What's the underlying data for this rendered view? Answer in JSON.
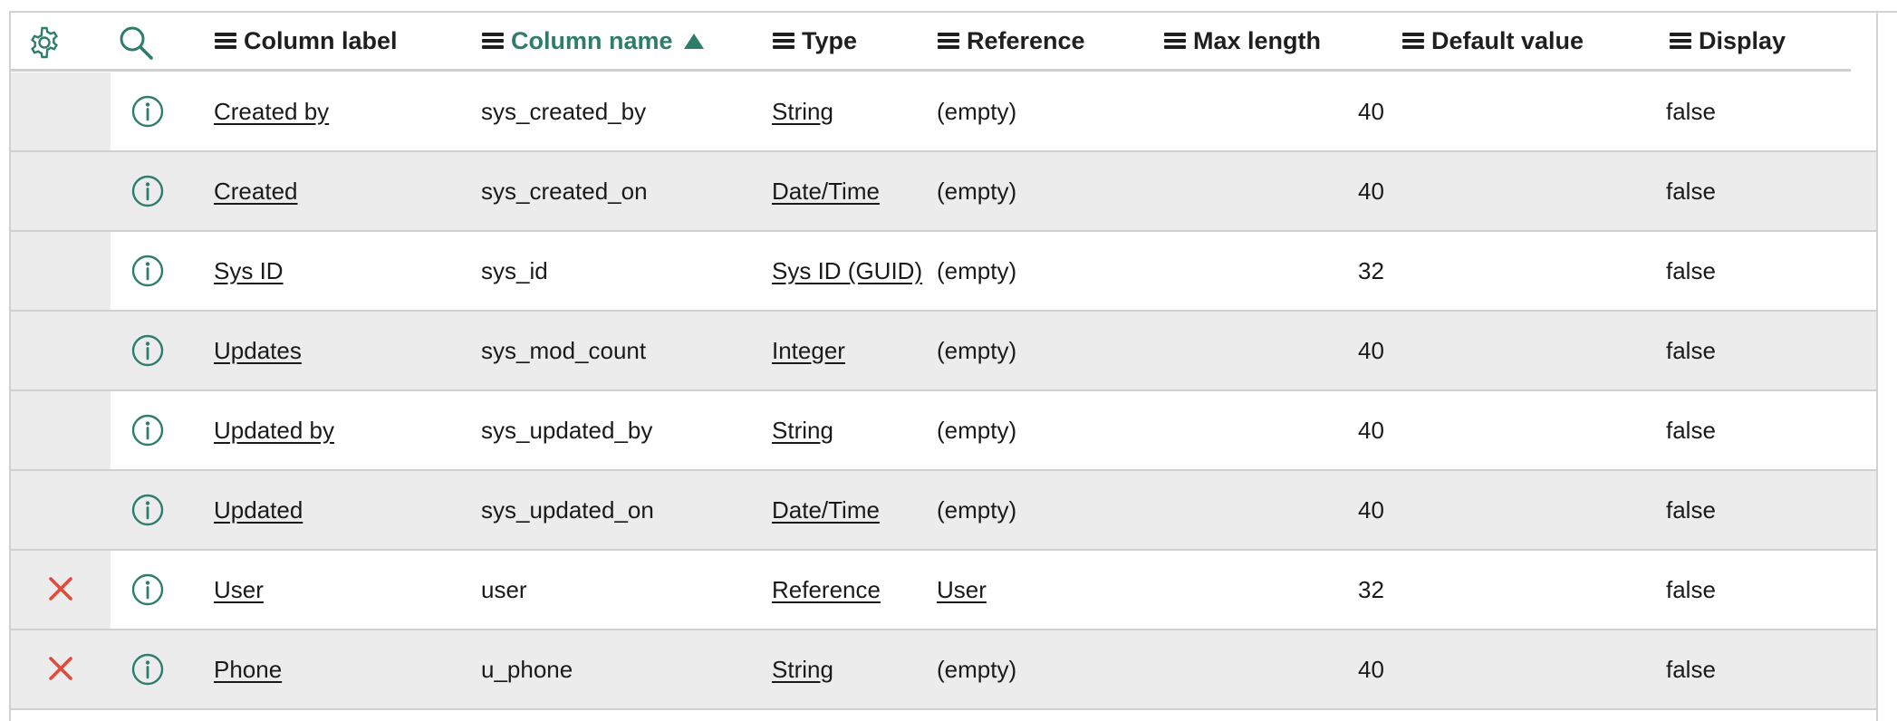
{
  "colors": {
    "accent": "#2e7d6b",
    "delete": "#e04b3c",
    "header_text": "#1f1f1f",
    "row_alt": "#ececec"
  },
  "header": {
    "settings_icon": "gear-icon",
    "search_icon": "search-icon",
    "columns": [
      {
        "label": "Column label",
        "sorted": false
      },
      {
        "label": "Column name",
        "sorted": true,
        "sort_direction": "ascending"
      },
      {
        "label": "Type",
        "sorted": false
      },
      {
        "label": "Reference",
        "sorted": false
      },
      {
        "label": "Max length",
        "sorted": false
      },
      {
        "label": "Default value",
        "sorted": false
      },
      {
        "label": "Display",
        "sorted": false
      }
    ]
  },
  "rows": [
    {
      "deletable": false,
      "label": "Created by",
      "name": "sys_created_by",
      "type": "String",
      "reference": "(empty)",
      "reference_link": false,
      "max_length": "40",
      "default_value": "",
      "display": "false"
    },
    {
      "deletable": false,
      "label": "Created",
      "name": "sys_created_on",
      "type": "Date/Time",
      "reference": "(empty)",
      "reference_link": false,
      "max_length": "40",
      "default_value": "",
      "display": "false"
    },
    {
      "deletable": false,
      "label": "Sys ID",
      "name": "sys_id",
      "type": "Sys ID (GUID)",
      "reference": "(empty)",
      "reference_link": false,
      "max_length": "32",
      "default_value": "",
      "display": "false"
    },
    {
      "deletable": false,
      "label": "Updates",
      "name": "sys_mod_count",
      "type": "Integer",
      "reference": "(empty)",
      "reference_link": false,
      "max_length": "40",
      "default_value": "",
      "display": "false"
    },
    {
      "deletable": false,
      "label": "Updated by",
      "name": "sys_updated_by",
      "type": "String",
      "reference": "(empty)",
      "reference_link": false,
      "max_length": "40",
      "default_value": "",
      "display": "false"
    },
    {
      "deletable": false,
      "label": "Updated",
      "name": "sys_updated_on",
      "type": "Date/Time",
      "reference": "(empty)",
      "reference_link": false,
      "max_length": "40",
      "default_value": "",
      "display": "false"
    },
    {
      "deletable": true,
      "label": "User",
      "name": "user",
      "type": "Reference",
      "reference": "User",
      "reference_link": true,
      "max_length": "32",
      "default_value": "",
      "display": "false"
    },
    {
      "deletable": true,
      "label": "Phone",
      "name": "u_phone",
      "type": "String",
      "reference": "(empty)",
      "reference_link": false,
      "max_length": "40",
      "default_value": "",
      "display": "false"
    }
  ]
}
